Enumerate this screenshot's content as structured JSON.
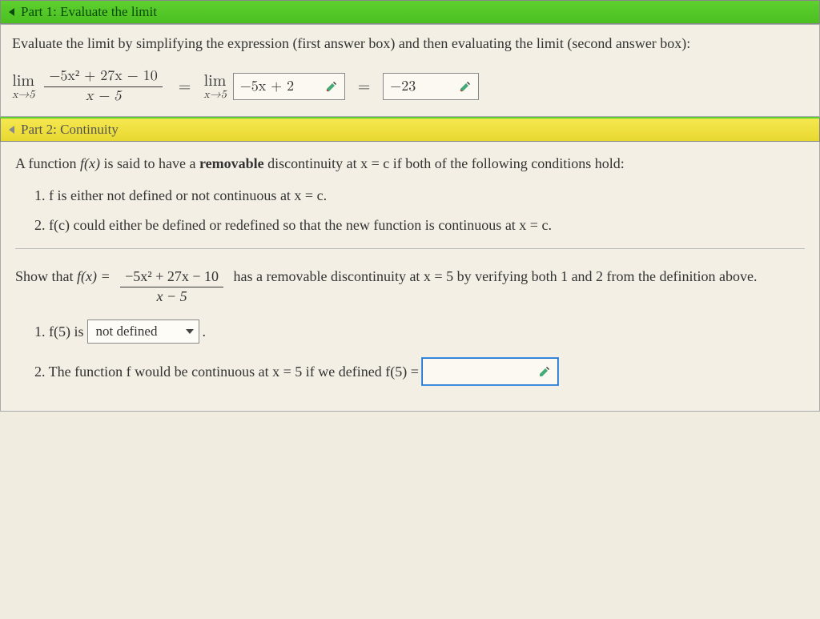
{
  "part1": {
    "header": "Part 1: Evaluate the limit",
    "instructions": "Evaluate the limit by simplifying the expression (first answer box) and then evaluating the limit (second answer box):",
    "limit_label": "lim",
    "limit_sub": "x→5",
    "numerator": "−5x² + 27x − 10",
    "denominator": "x − 5",
    "answer1": "−5x + 2",
    "answer2": "−23"
  },
  "part2": {
    "header": "Part 2: Continuity",
    "intro_pre": "A function ",
    "intro_fx": "f(x)",
    "intro_mid": " is said to have a ",
    "intro_bold": "removable",
    "intro_post": " discontinuity at x = c if both of the following conditions hold:",
    "cond1": "1. f is either not defined or not continuous at x = c.",
    "cond2": "2. f(c) could either be defined or redefined so that the new function is continuous at x = c.",
    "show_pre": "Show that ",
    "show_fx": "f(x) = ",
    "show_num": "−5x² + 27x − 10",
    "show_den": "x − 5",
    "show_post": " has a removable discontinuity at x = 5 by verifying both 1 and 2 from the definition above.",
    "v1_pre": "1. f(5) is ",
    "v1_selected": "not defined",
    "v1_post": ".",
    "v2_pre": "2. The function f would be continuous at x = 5 if we defined f(5) = ",
    "v2_answer": ""
  }
}
